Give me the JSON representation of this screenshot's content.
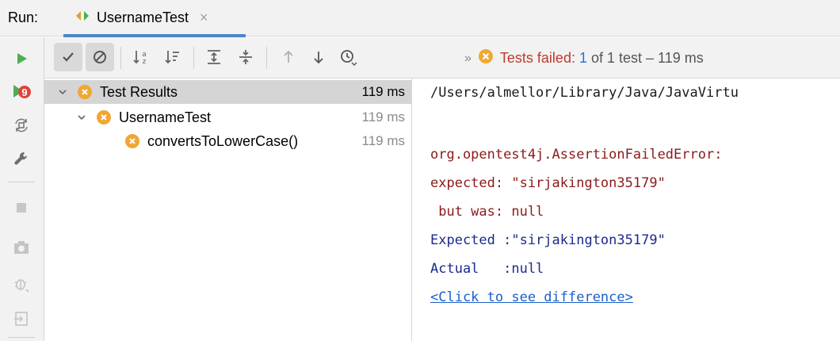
{
  "header": {
    "run_label": "Run:",
    "tab_label": "UsernameTest",
    "close_glyph": "×"
  },
  "status": {
    "prefix": "Tests failed:",
    "failed_count": "1",
    "suffix": "of 1 test – 119 ms",
    "overflow_glyph": "»"
  },
  "tree": {
    "rows": [
      {
        "label": "Test Results",
        "time": "119 ms",
        "selected": true
      },
      {
        "label": "UsernameTest",
        "time": "119 ms",
        "selected": false
      },
      {
        "label": "convertsToLowerCase()",
        "time": "119 ms",
        "selected": false
      }
    ]
  },
  "console": {
    "lines": [
      "/Users/almellor/Library/Java/JavaVirtu",
      "org.opentest4j.AssertionFailedError:",
      "expected: \"sirjakington35179\"",
      " but was: null",
      "Expected :\"sirjakington35179\"",
      "Actual   :null",
      "<Click to see difference>"
    ]
  },
  "icons": {
    "left_toolbar": [
      "run-icon",
      "rerun-failed-icon",
      "toggle-auto-test-icon",
      "settings-wrench-icon",
      "stop-icon",
      "screenshot-camera-icon",
      "debug-icon",
      "export-icon"
    ],
    "top_toolbar": [
      "show-passed-icon",
      "show-ignored-icon",
      "sort-alphabetically-icon",
      "sort-by-duration-icon",
      "expand-all-icon",
      "collapse-all-icon",
      "previous-failed-icon",
      "next-failed-icon",
      "test-history-icon"
    ]
  },
  "colors": {
    "fail": "#f0a732",
    "status_red": "#c0392b",
    "run_green": "#4caf50",
    "tab_accent": "#4a88c7"
  }
}
